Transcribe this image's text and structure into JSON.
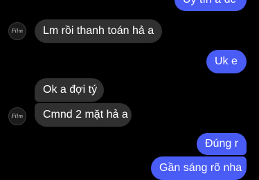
{
  "conversation": {
    "contact": {
      "avatar_text": "Film"
    },
    "messages": [
      {
        "direction": "outgoing",
        "text": "Uy tín a dc"
      },
      {
        "direction": "incoming",
        "text": "Lm rồi thanh toán hả a"
      },
      {
        "direction": "outgoing",
        "text": "Uk e"
      },
      {
        "direction": "incoming",
        "text": "Ok a đợi tý"
      },
      {
        "direction": "incoming",
        "text": "Cmnd 2 mặt hả a"
      },
      {
        "direction": "outgoing",
        "text": "Đúng r"
      },
      {
        "direction": "outgoing",
        "text": "Gần sáng rõ nha"
      }
    ]
  },
  "colors": {
    "background": "#000000",
    "incoming_bubble": "#303030",
    "outgoing_bubble": "#4a5cf6",
    "text": "#ffffff"
  }
}
